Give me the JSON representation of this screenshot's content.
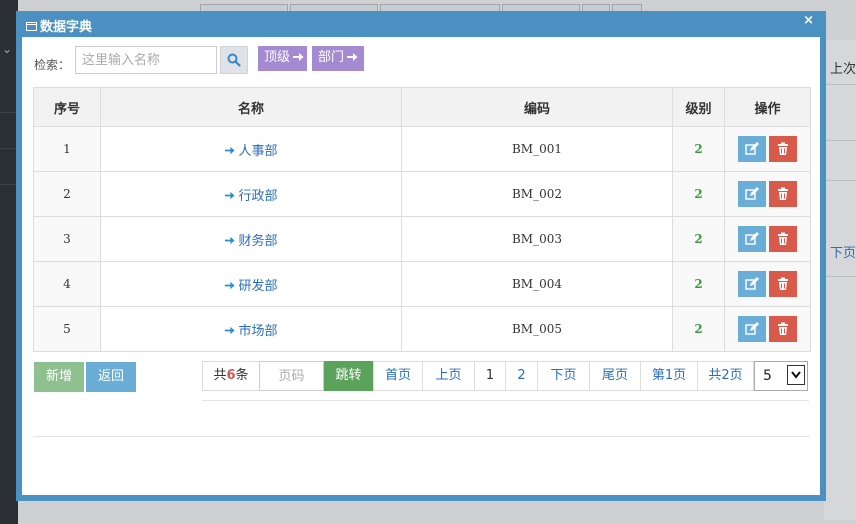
{
  "background": {
    "right_texts": [
      "上次",
      "下页"
    ]
  },
  "modal": {
    "title": "数据字典",
    "close_symbol": "×"
  },
  "search": {
    "label": "检索：",
    "placeholder": "这里输入名称",
    "btn_top": "顶级",
    "btn_dept": "部门"
  },
  "table": {
    "headers": [
      "序号",
      "名称",
      "编码",
      "级别",
      "操作"
    ],
    "rows": [
      {
        "index": "1",
        "name": "人事部",
        "code": "BM_001",
        "level": "2"
      },
      {
        "index": "2",
        "name": "行政部",
        "code": "BM_002",
        "level": "2"
      },
      {
        "index": "3",
        "name": "财务部",
        "code": "BM_003",
        "level": "2"
      },
      {
        "index": "4",
        "name": "研发部",
        "code": "BM_004",
        "level": "2"
      },
      {
        "index": "5",
        "name": "市场部",
        "code": "BM_005",
        "level": "2"
      }
    ]
  },
  "actions": {
    "add": "新增",
    "back": "返回"
  },
  "pager": {
    "total_prefix": "共",
    "total_count": "6",
    "total_suffix": "条",
    "page_placeholder": "页码",
    "jump": "跳转",
    "first": "首页",
    "prev": "上页",
    "pages": [
      "1",
      "2"
    ],
    "next": "下页",
    "last": "尾页",
    "current_page": "第1页",
    "total_pages": "共2页",
    "page_size": "5"
  },
  "colors": {
    "modal_border": "#4a90c0",
    "link": "#2a6ebb",
    "level": "#3c9c3c",
    "purple_button": "#a48ad1",
    "edit_button": "#6aaed8",
    "delete_button": "#d85a4a",
    "add_button": "#8fc08f",
    "jump_button": "#5ba35b"
  }
}
